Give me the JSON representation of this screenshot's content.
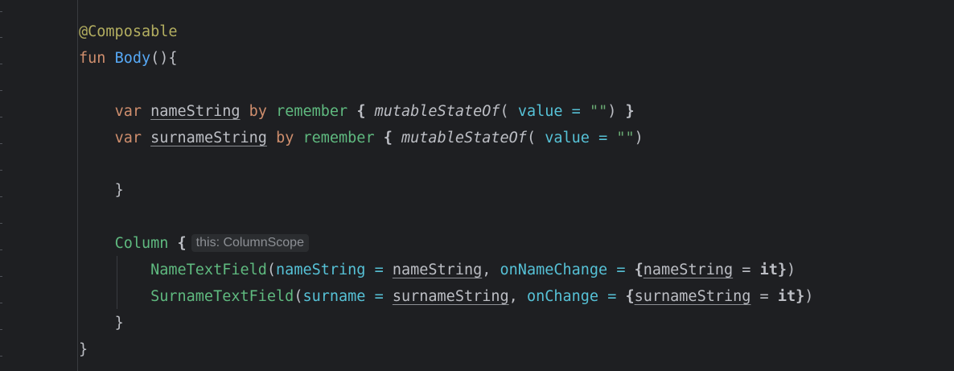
{
  "editor": {
    "theme": {
      "background": "#1e1f22",
      "keyword": "#cf8e6d",
      "annotation": "#b3ae60",
      "function_decl": "#56a8f5",
      "composable_call": "#5fb97f",
      "named_param": "#56c1d6",
      "string": "#6aab73",
      "default_text": "#bcbec4"
    },
    "lines": {
      "l1": {
        "annotation": "@Composable"
      },
      "l2": {
        "kw_fun": "fun",
        "fn_name": "Body",
        "tail": "(){"
      },
      "l4": {
        "kw_var": "var",
        "var_name": "nameString",
        "kw_by": "by",
        "call": "remember",
        "brace_open": "{",
        "func": "mutableStateOf",
        "paren_open": "(",
        "param": "value",
        "eq": "=",
        "str": "\"\"",
        "paren_close": ")",
        "brace_close": "}"
      },
      "l5": {
        "kw_var": "var",
        "var_name": "surnameString",
        "kw_by": "by",
        "call": "remember",
        "brace_open": "{",
        "func": "mutableStateOf",
        "paren_open": "(",
        "param": "value",
        "eq": "=",
        "str": "\"\"",
        "paren_close": ")"
      },
      "l7": {
        "brace": "}"
      },
      "l9": {
        "call": "Column",
        "brace": "{",
        "hint": "this: ColumnScope"
      },
      "l10": {
        "call": "NameTextField",
        "paren_open": "(",
        "param1": "nameString",
        "eq1": "=",
        "arg1": "nameString",
        "comma": ",",
        "param2": "onNameChange",
        "eq2": "=",
        "brace_open": "{",
        "lambda_var": "nameString",
        "eq3": "=",
        "it": "it",
        "brace_close": "}",
        "paren_close": ")"
      },
      "l11": {
        "call": "SurnameTextField",
        "paren_open": "(",
        "param1": "surname",
        "eq1": "=",
        "arg1": "surnameString",
        "comma": ",",
        "param2": "onChange",
        "eq2": "=",
        "brace_open": "{",
        "lambda_var": "surnameString",
        "eq3": "=",
        "it": "it",
        "brace_close": "}",
        "paren_close": ")"
      },
      "l12": {
        "brace": "}"
      },
      "l13": {
        "brace": "}"
      }
    }
  }
}
